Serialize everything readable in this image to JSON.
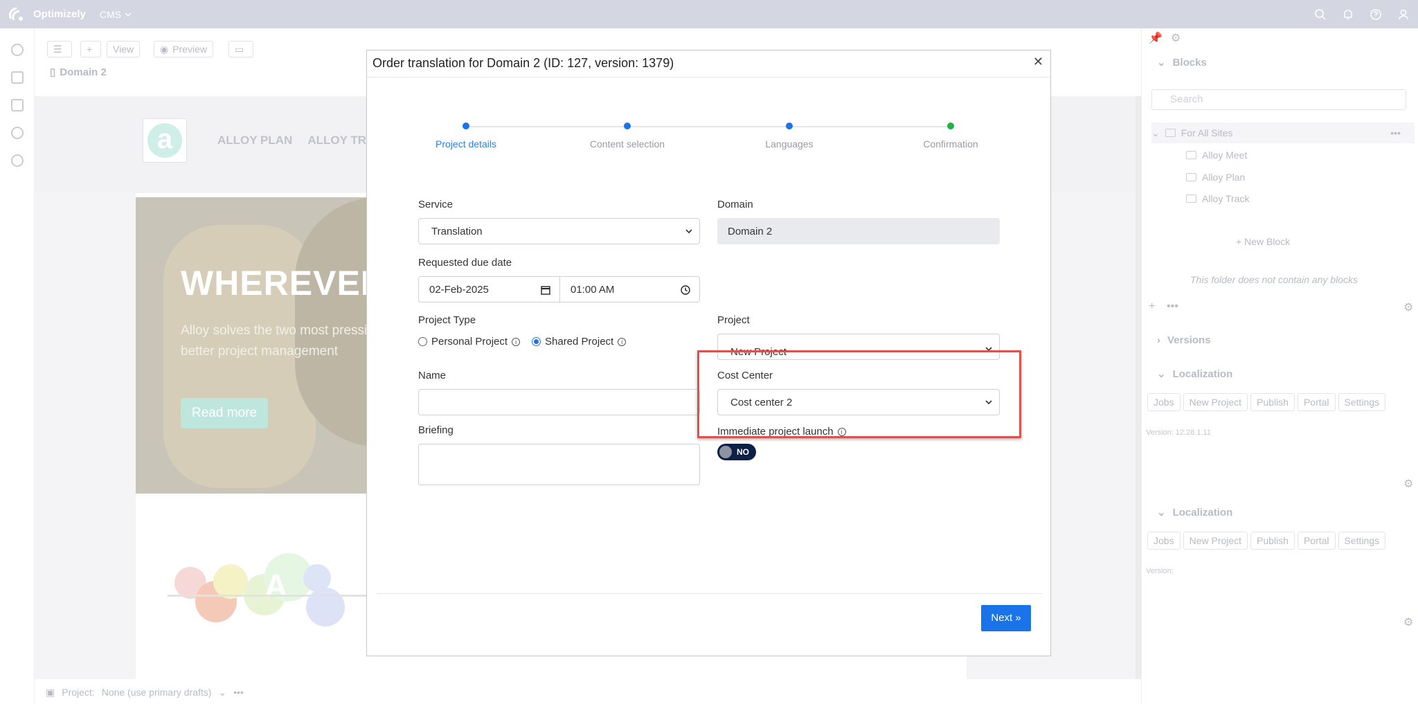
{
  "topbar": {
    "brand": "Optimizely",
    "product": "CMS",
    "icons": [
      "search-icon",
      "bell-icon",
      "help-icon",
      "user-icon"
    ]
  },
  "toolbar": {
    "view_label": "View",
    "preview_label": "Preview"
  },
  "breadcrumb": {
    "page": "Domain 2"
  },
  "site": {
    "nav": [
      "ALLOY PLAN",
      "ALLOY TRAC"
    ],
    "hero_title": "WHEREVER",
    "hero_text": "Alloy solves the two most pressi better project management",
    "hero_button": "Read more",
    "ball_letter": "A"
  },
  "project_bar": {
    "label": "Project:",
    "value": "None (use primary drafts)"
  },
  "right_panel": {
    "blocks_title": "Blocks",
    "search_placeholder": "Search",
    "folders": [
      {
        "label": "For All Sites"
      },
      {
        "label": "Alloy Meet"
      },
      {
        "label": "Alloy Plan"
      },
      {
        "label": "Alloy Track"
      }
    ],
    "new_block": "New Block",
    "empty_message": "This folder does not contain any blocks",
    "versions_title": "Versions",
    "localization_title": "Localization",
    "loc_buttons": [
      "Jobs",
      "New Project",
      "Publish",
      "Portal",
      "Settings"
    ],
    "version_text_1": "Version: 12.28.1.11",
    "version_text_2": "Version:"
  },
  "modal": {
    "title": "Order translation for Domain 2 (ID: 127, version: 1379)",
    "steps": [
      {
        "label": "Project details"
      },
      {
        "label": "Content selection"
      },
      {
        "label": "Languages"
      },
      {
        "label": "Confirmation"
      }
    ],
    "service_label": "Service",
    "service_value": "Translation",
    "domain_label": "Domain",
    "domain_value": "Domain 2",
    "due_label": "Requested due date",
    "due_date": "02-Feb-2025",
    "due_time": "01:00 AM",
    "project_type_label": "Project Type",
    "project_type_options": [
      "Personal Project",
      "Shared Project"
    ],
    "project_type_selected": "Shared Project",
    "project_label": "Project",
    "project_value": "New Project",
    "name_label": "Name",
    "name_value": "",
    "cost_center_label": "Cost Center",
    "cost_center_value": "Cost center 2",
    "briefing_label": "Briefing",
    "briefing_value": "",
    "immediate_label": "Immediate project launch",
    "immediate_value": "NO",
    "next_label": "Next »"
  },
  "colors": {
    "accent": "#1a73e8",
    "highlight": "#d9534f",
    "toggle": "#0d2046",
    "complete": "#1db445"
  }
}
